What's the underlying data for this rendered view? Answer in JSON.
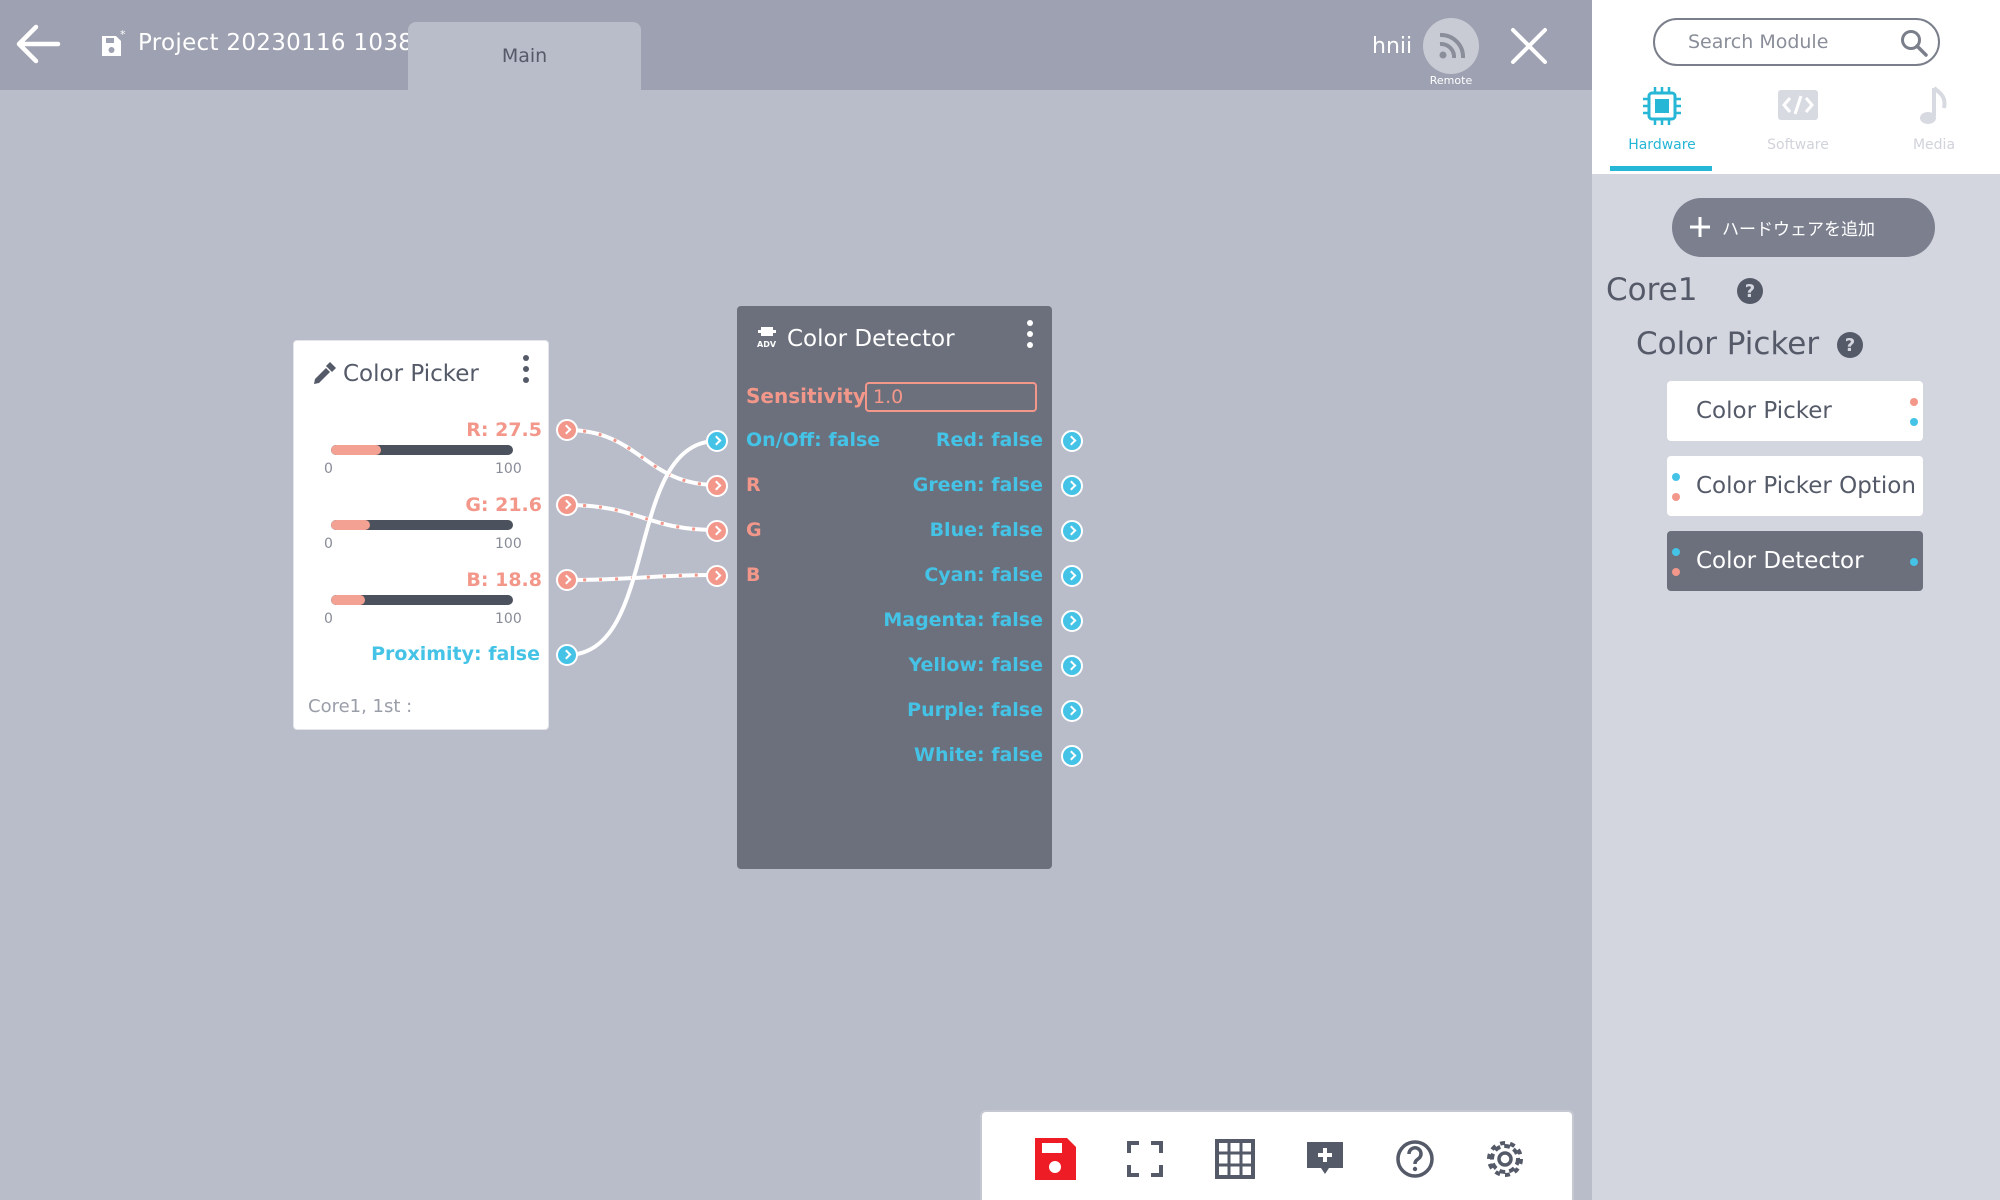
{
  "header": {
    "project_title": "Project 20230116 1038",
    "tabs": [
      {
        "label": "Main",
        "active": true
      }
    ],
    "user_name": "hnii",
    "remote_label": "Remote"
  },
  "nodes": {
    "color_picker": {
      "title": "Color Picker",
      "sliders": [
        {
          "label": "R: 27.5",
          "value": 27.5,
          "min": "0",
          "max": "100"
        },
        {
          "label": "G: 21.6",
          "value": 21.6,
          "min": "0",
          "max": "100"
        },
        {
          "label": "B: 18.8",
          "value": 18.8,
          "min": "0",
          "max": "100"
        }
      ],
      "proximity_label": "Proximity: false",
      "footer": "Core1, 1st :"
    },
    "color_detector": {
      "title": "Color Detector",
      "sensitivity_label": "Sensitivity",
      "sensitivity_value": "1.0",
      "inputs": [
        "On/Off: false",
        "R",
        "G",
        "B"
      ],
      "outputs": [
        "Red: false",
        "Green: false",
        "Blue: false",
        "Cyan: false",
        "Magenta: false",
        "Yellow: false",
        "Purple: false",
        "White: false"
      ]
    }
  },
  "sidebar": {
    "search_placeholder": "Search Module",
    "categories": [
      {
        "label": "Hardware",
        "active": true
      },
      {
        "label": "Software",
        "active": false
      },
      {
        "label": "Media",
        "active": false
      }
    ],
    "add_hardware_label": "ハードウェアを追加",
    "core_label": "Core1",
    "group_label": "Color Picker",
    "modules": [
      {
        "label": "Color Picker",
        "active": false
      },
      {
        "label": "Color Picker Option",
        "active": false
      },
      {
        "label": "Color Detector",
        "active": true
      }
    ]
  },
  "toolbar": {
    "icons": [
      "save-icon",
      "fullscreen-icon",
      "grid-icon",
      "add-comment-icon",
      "help-icon",
      "settings-icon"
    ]
  },
  "colors": {
    "accent": "#26b6d6",
    "input_port": "#f3978a",
    "output_port": "#44c3e6",
    "save_red": "#ee1c24"
  }
}
